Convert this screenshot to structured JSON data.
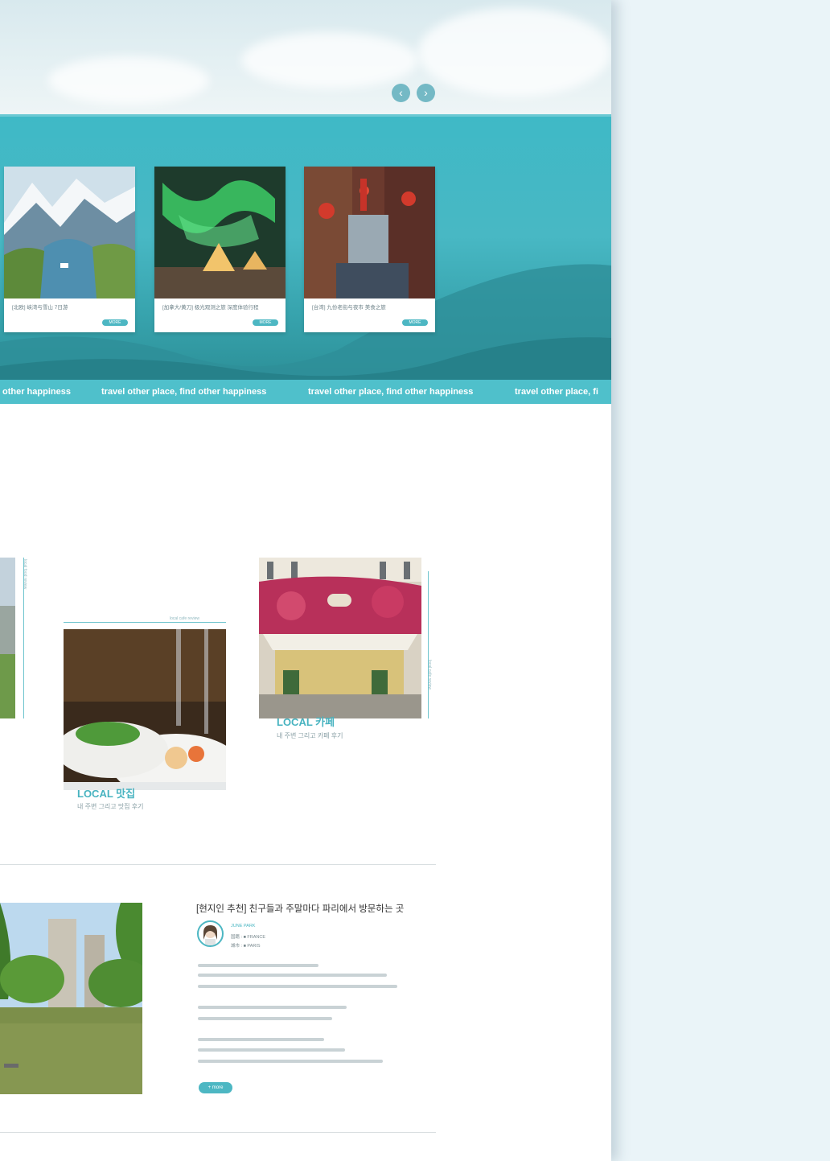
{
  "hero": {
    "prev_icon": "‹",
    "next_icon": "›"
  },
  "cards": [
    {
      "caption": "[北欧] 峡湾与雪山 7日游",
      "more": "MORE"
    },
    {
      "caption": "[加拿大/黄刀] 极光观测之旅 深度体验行程",
      "more": "MORE"
    },
    {
      "caption": "[台湾] 九份老街与夜市 美食之旅",
      "more": "MORE"
    }
  ],
  "ticker": {
    "items": [
      "other happiness",
      "travel other place, find other happiness",
      "travel other place, find other happiness",
      "travel other place, fi"
    ]
  },
  "local": {
    "vtext_left": "local food review",
    "vtext_mid": "local cafe review",
    "vtext_right": "local cafe review",
    "food_title": "LOCAL 맛집",
    "food_sub": "내 주변 그리고 맛집 후기",
    "cafe_title": "LOCAL 카페",
    "cafe_sub": "내 주변 그리고 카페 후기"
  },
  "blog": {
    "title": "[현지인 추천] 친구들과 주말마다 파리에서 방문하는 곳",
    "author_line": "JUNE PARK",
    "meta_1": "国籍 :  ■ FRANCE",
    "meta_2": "城市 :  ■ PARIS",
    "more": "+ more"
  },
  "colors": {
    "accent": "#4db7c3",
    "band": "#3fb9c6",
    "background": "#eaf4f8"
  }
}
